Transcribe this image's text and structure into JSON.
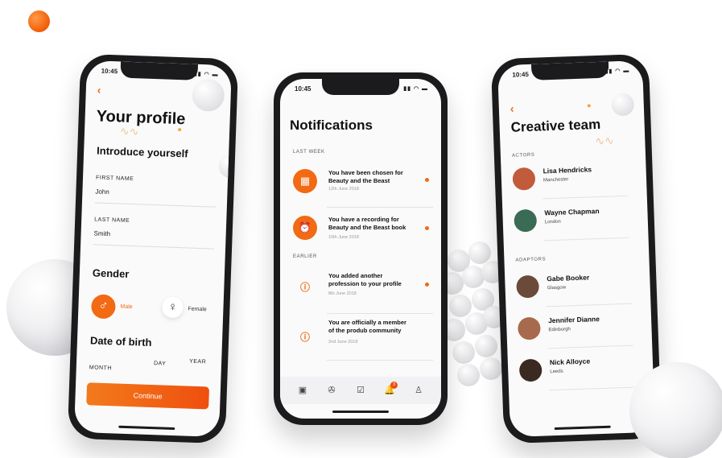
{
  "colors": {
    "accent": "#f26a14",
    "accent_dark": "#ef4f0e"
  },
  "profile_screen": {
    "time": "10:45",
    "back_icon": "chevron-left-icon",
    "title": "Your profile",
    "intro_heading": "Introduce yourself",
    "first_name": {
      "label": "FIRST NAME",
      "value": "John"
    },
    "last_name": {
      "label": "LAST NAME",
      "value": "Smith"
    },
    "gender_heading": "Gender",
    "gender_options": [
      {
        "label": "Male",
        "icon": "male-symbol-icon",
        "selected": true
      },
      {
        "label": "Female",
        "icon": "female-symbol-icon",
        "selected": false
      }
    ],
    "dob_heading": "Date of birth",
    "dob_columns": [
      "MONTH",
      "DAY",
      "YEAR"
    ],
    "continue_label": "Continue"
  },
  "notifications_screen": {
    "time": "10:45",
    "title": "Notifications",
    "sections": [
      {
        "label": "LAST WEEK",
        "items": [
          {
            "icon": "calendar-icon",
            "text": "You have been chosen for Beauty and the Beast",
            "date": "12th June 2018",
            "unread": true
          },
          {
            "icon": "alarm-clock-icon",
            "text": "You have a recording for Beauty and the Beast book",
            "date": "10th June 2018",
            "unread": true
          }
        ]
      },
      {
        "label": "EARLIER",
        "items": [
          {
            "icon": "info-icon",
            "text": "You added another profession to your profile",
            "date": "8th June 2018",
            "unread": true
          },
          {
            "icon": "info-icon",
            "text": "You are officially a member of the produb community",
            "date": "2nd June 2018",
            "unread": false
          }
        ]
      }
    ],
    "tabbar": [
      {
        "icon": "id-card-icon",
        "active": false
      },
      {
        "icon": "film-reel-icon",
        "active": false
      },
      {
        "icon": "check-box-icon",
        "active": false
      },
      {
        "icon": "bell-icon",
        "active": true,
        "badge": "3"
      },
      {
        "icon": "user-icon",
        "active": false
      }
    ]
  },
  "team_screen": {
    "time": "10:45",
    "back_icon": "chevron-left-icon",
    "title": "Creative team",
    "sections": [
      {
        "label": "ACTORS",
        "members": [
          {
            "name": "Lisa Hendricks",
            "city": "Manchester",
            "avatar_color": "#c25a3c"
          },
          {
            "name": "Wayne Chapman",
            "city": "London",
            "avatar_color": "#3a6b54"
          }
        ]
      },
      {
        "label": "ADAPTORS",
        "members": [
          {
            "name": "Gabe Booker",
            "city": "Glasgow",
            "avatar_color": "#6b4a3a"
          },
          {
            "name": "Jennifer Dianne",
            "city": "Edinburgh",
            "avatar_color": "#a86a4c"
          },
          {
            "name": "Nick Alloyce",
            "city": "Leeds",
            "avatar_color": "#3b2a22"
          }
        ]
      }
    ]
  }
}
